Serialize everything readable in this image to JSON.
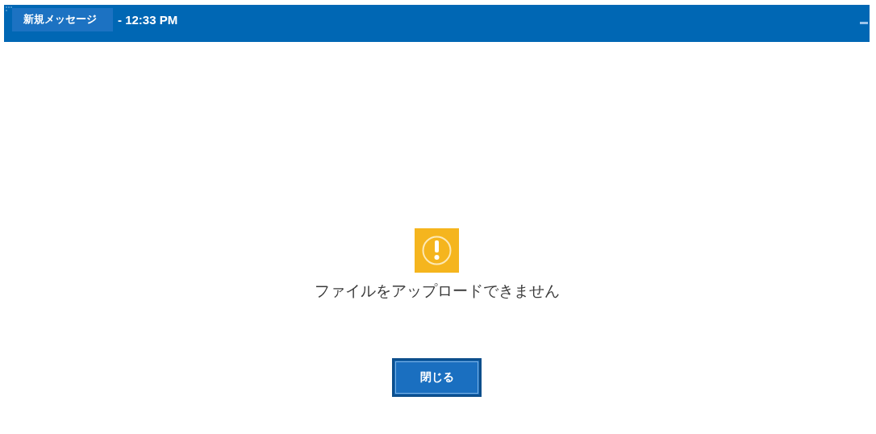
{
  "title_bar": {
    "tab": "新規メッセージ",
    "time": "- 12:33 PM"
  },
  "dialog": {
    "message": "ファイルをアップロードできません",
    "button": "閉じる"
  }
}
